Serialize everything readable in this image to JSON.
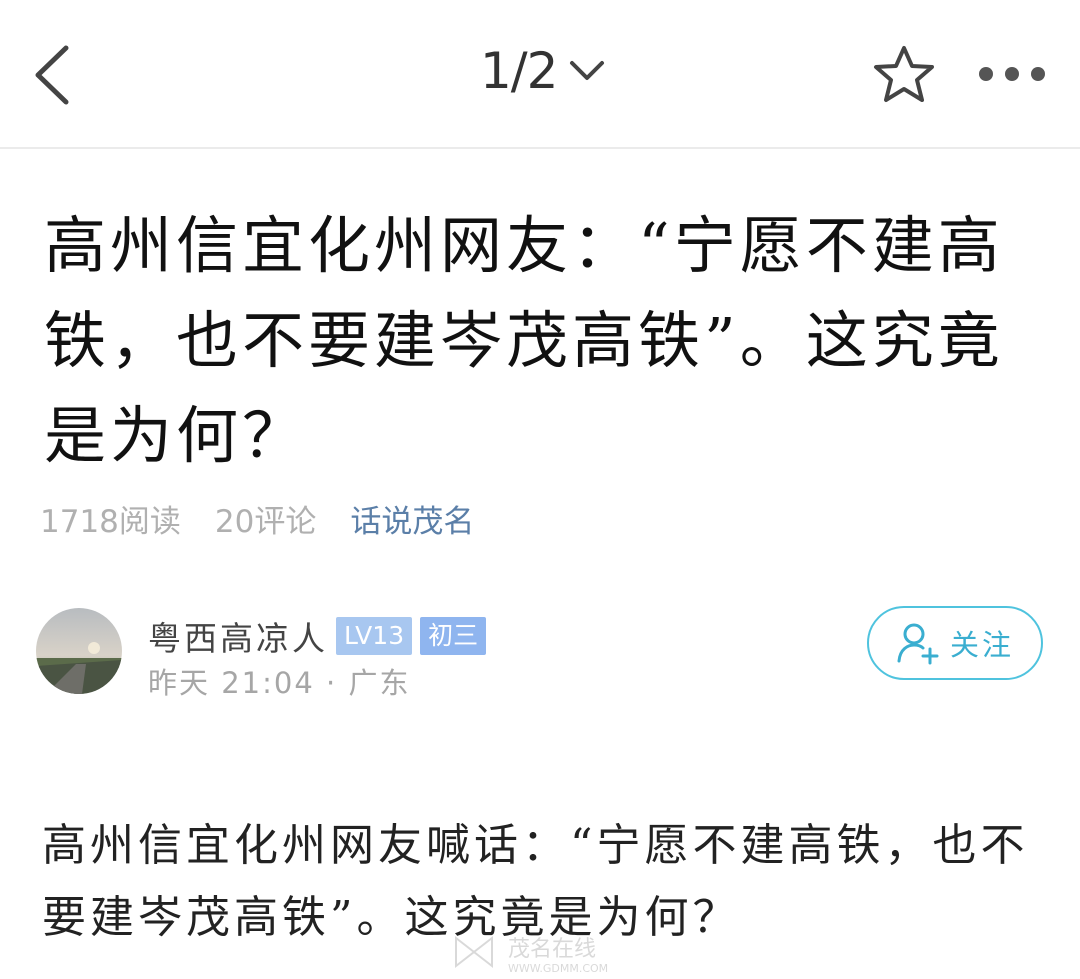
{
  "header": {
    "pager": "1/2",
    "icons": [
      "back-icon",
      "chevron-down-icon",
      "star-icon",
      "more-icon"
    ]
  },
  "post": {
    "title": "高州信宜化州网友：“宁愿不建高铁，也不要建岑茂高铁”。这究竟是为何？",
    "reads": "1718阅读",
    "comments": "20评论",
    "topic": "话说茂名",
    "body": "高州信宜化州网友喊话：“宁愿不建高铁，也不要建岑茂高铁”。这究竟是为何？"
  },
  "author": {
    "name": "粤西高凉人",
    "level": "LV13",
    "rank": "初三",
    "time": "昨天 21:04 · 广东"
  },
  "follow": {
    "label": "关注"
  },
  "watermark": {
    "brand": "茂名在线",
    "url": "WWW.GDMM.COM"
  },
  "colors": {
    "topic": "#5b7fa8",
    "follow_accent": "#4fc3de",
    "badge_lv": "#a8c7f0",
    "badge_rank": "#8fb5ef"
  }
}
